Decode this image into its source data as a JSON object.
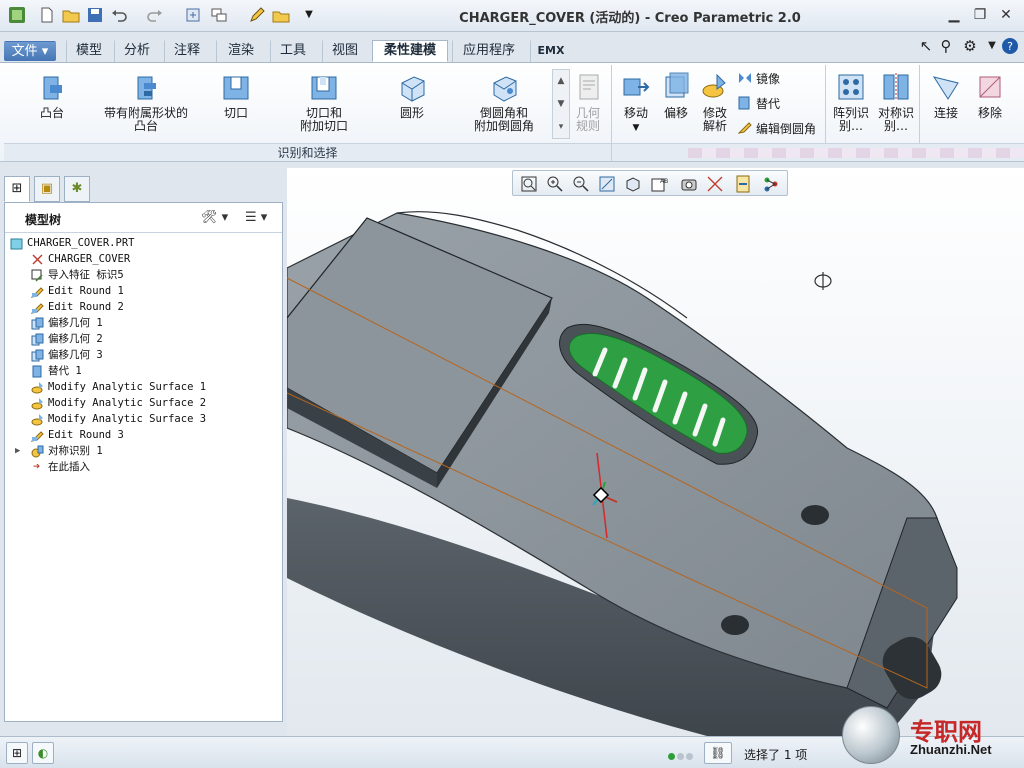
{
  "window": {
    "title": "CHARGER_COVER (活动的) - Creo Parametric 2.0"
  },
  "menu_tabs": {
    "file": "文件",
    "items": [
      "模型",
      "分析",
      "注释",
      "渲染",
      "工具",
      "视图",
      "柔性建模",
      "应用程序",
      "EMX"
    ],
    "active": "柔性建模"
  },
  "ribbon": {
    "recognize_select": {
      "label": "识别和选择",
      "buttons": [
        {
          "label": "凸台"
        },
        {
          "label": "带有附属形状的\n凸台"
        },
        {
          "label": "切口"
        },
        {
          "label": "切口和\n附加切口"
        },
        {
          "label": "圆形"
        },
        {
          "label": "倒圆角和\n附加倒圆角"
        }
      ],
      "geometry_rule": "几何\n规则"
    },
    "transform": {
      "move": "移动",
      "offset": "偏移",
      "modify_analytic": "修改\n解析",
      "mirror": "镜像",
      "substitute": "替代",
      "edit_round": "编辑倒圆角"
    },
    "recognition": {
      "pattern": "阵列识\n别…",
      "symmetry": "对称识\n别…"
    },
    "edit": {
      "connect": "连接",
      "remove": "移除"
    }
  },
  "model_tree": {
    "title": "模型树",
    "items": [
      {
        "label": "CHARGER_COVER.PRT",
        "level": 0,
        "icon": "part-icon"
      },
      {
        "label": "CHARGER_COVER",
        "level": 1,
        "icon": "csys-icon"
      },
      {
        "label": "导入特征 标识5",
        "level": 1,
        "icon": "import-feature-icon"
      },
      {
        "label": "Edit Round 1",
        "level": 1,
        "icon": "edit-round-icon"
      },
      {
        "label": "Edit Round 2",
        "level": 1,
        "icon": "edit-round-icon"
      },
      {
        "label": "偏移几何 1",
        "level": 1,
        "icon": "offset-geom-icon"
      },
      {
        "label": "偏移几何 2",
        "level": 1,
        "icon": "offset-geom-icon"
      },
      {
        "label": "偏移几何 3",
        "level": 1,
        "icon": "offset-geom-icon"
      },
      {
        "label": "替代 1",
        "level": 1,
        "icon": "substitute-icon"
      },
      {
        "label": "Modify Analytic Surface 1",
        "level": 1,
        "icon": "modify-analytic-icon"
      },
      {
        "label": "Modify Analytic Surface 2",
        "level": 1,
        "icon": "modify-analytic-icon"
      },
      {
        "label": "Modify Analytic Surface 3",
        "level": 1,
        "icon": "modify-analytic-icon"
      },
      {
        "label": "Edit Round 3",
        "level": 1,
        "icon": "edit-round-icon"
      },
      {
        "label": "对称识别 1",
        "level": 1,
        "icon": "symmetry-icon",
        "expandable": true
      },
      {
        "label": "在此插入",
        "level": 1,
        "icon": "insert-here-icon"
      }
    ]
  },
  "status_bar": {
    "selection": "选择了 1 项"
  },
  "watermark": {
    "text_cn": "专职网",
    "url": "Zhuanzhi.Net"
  },
  "colors": {
    "accent_tab": "#4575b4",
    "model_body": "#8a9299",
    "vent_green": "#2ea043",
    "datum_orange": "#b5651d"
  }
}
